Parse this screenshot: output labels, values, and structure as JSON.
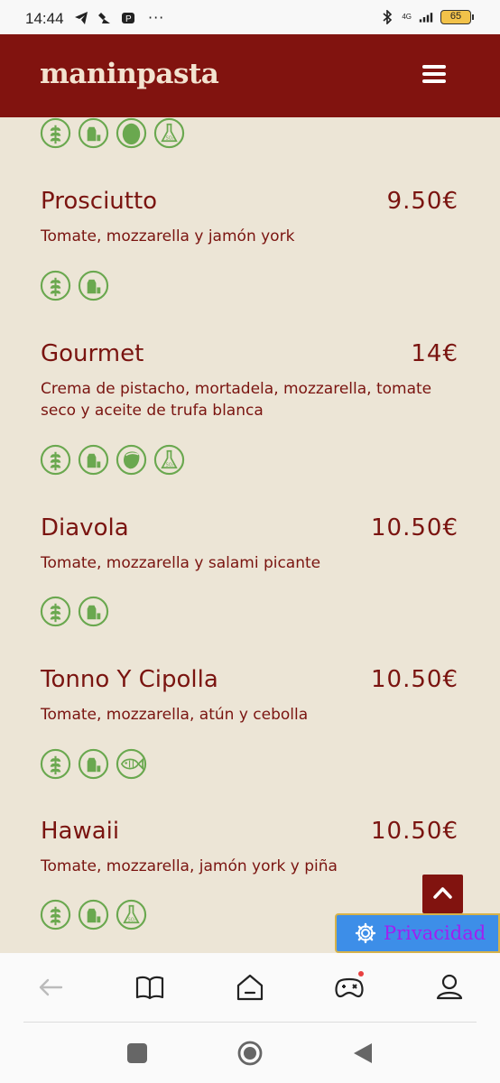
{
  "status_bar": {
    "time": "14:44",
    "more": "···",
    "network": "4G",
    "battery": "65",
    "icons": [
      "telegram-icon",
      "cleaner-icon",
      "parking-icon",
      "bluetooth-icon",
      "signal-icon"
    ]
  },
  "header": {
    "logo": "maninpasta",
    "menu_icon": "hamburger-menu-icon"
  },
  "menu": {
    "items": [
      {
        "name": "Prosciutto",
        "price": "9.50€",
        "description": "Tomate, mozzarella y jamón york",
        "allergens": [
          "gluten",
          "lactose"
        ]
      },
      {
        "name": "Gourmet",
        "price": "14€",
        "description": "Crema de pistacho, mortadela, mozzarella, tomate seco y aceite de trufa blanca",
        "allergens": [
          "gluten",
          "lactose",
          "nuts",
          "sulfites"
        ]
      },
      {
        "name": "Diavola",
        "price": "10.50€",
        "description": "Tomate, mozzarella y salami picante",
        "allergens": [
          "gluten",
          "lactose"
        ]
      },
      {
        "name": "Tonno Y Cipolla",
        "price": "10.50€",
        "description": "Tomate, mozzarella, atún y cebolla",
        "allergens": [
          "gluten",
          "lactose",
          "fish"
        ]
      },
      {
        "name": "Hawaii",
        "price": "10.50€",
        "description": "Tomate, mozzarella, jamón york y piña",
        "allergens": [
          "gluten",
          "lactose",
          "sulfites"
        ]
      }
    ],
    "top_partial_allergens": [
      "gluten",
      "lactose",
      "olive",
      "sulfites"
    ]
  },
  "privacy_button": {
    "label": "Privacidad"
  },
  "colors": {
    "brand_red": "#81130f",
    "text_red": "#7a1410",
    "background": "#ece5d6",
    "allergen_green": "#6aa84f",
    "privacy_blue": "#3d8ee8",
    "privacy_text": "#a020f0"
  },
  "bottom_nav": [
    "back-icon",
    "book-icon",
    "home-icon",
    "game-icon",
    "profile-icon"
  ],
  "system_nav": [
    "recent-apps-icon",
    "home-circle-icon",
    "back-triangle-icon"
  ]
}
